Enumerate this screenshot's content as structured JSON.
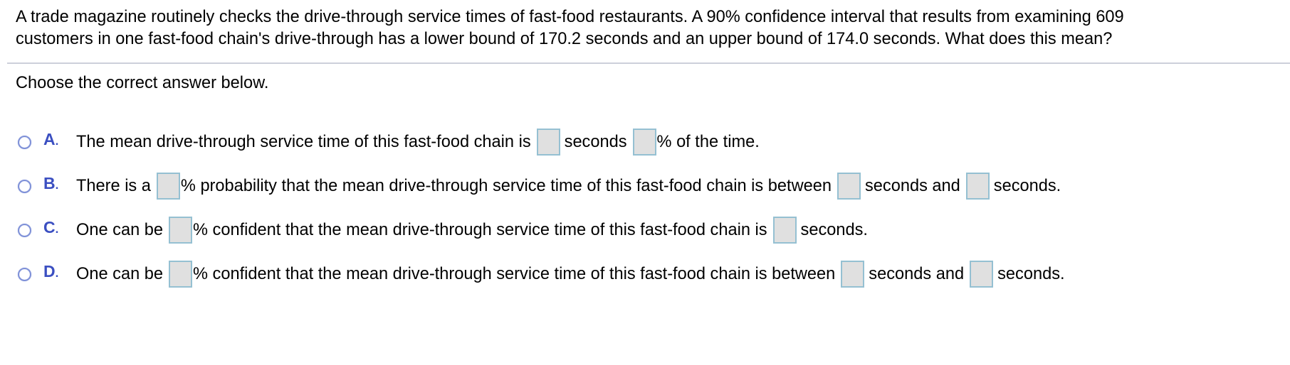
{
  "question": {
    "prompt_line1": "A trade magazine routinely checks the drive-through service times of fast-food restaurants. A 90% confidence interval that results from examining 609",
    "prompt_line2": "customers in one fast-food chain's drive-through has a lower bound of 170.2 seconds and an upper bound of 174.0 seconds. What does this mean?",
    "instruction": "Choose the correct answer below."
  },
  "options": [
    {
      "letter": "A",
      "segments": [
        "The mean drive-through service time of this fast-food chain is",
        "seconds",
        "% of the time."
      ]
    },
    {
      "letter": "B",
      "segments": [
        "There is a",
        "% probability that the mean drive-through service time of this fast-food chain is between",
        "seconds and",
        "seconds."
      ]
    },
    {
      "letter": "C",
      "segments": [
        "One can be",
        "% confident that the mean drive-through service time of this fast-food chain is",
        "seconds."
      ]
    },
    {
      "letter": "D",
      "segments": [
        "One can be",
        "% confident that the mean drive-through service time of this fast-food chain is between",
        "seconds and",
        "seconds."
      ]
    }
  ],
  "blanks": {
    "value": "",
    "placeholder": ""
  },
  "colors": {
    "option_letter": "#3b4fc1",
    "radio_ring": "#7f91d8",
    "blank_fill": "#e0e0e0",
    "blank_border": "#95c0d2",
    "divider": "#cdd0da"
  }
}
